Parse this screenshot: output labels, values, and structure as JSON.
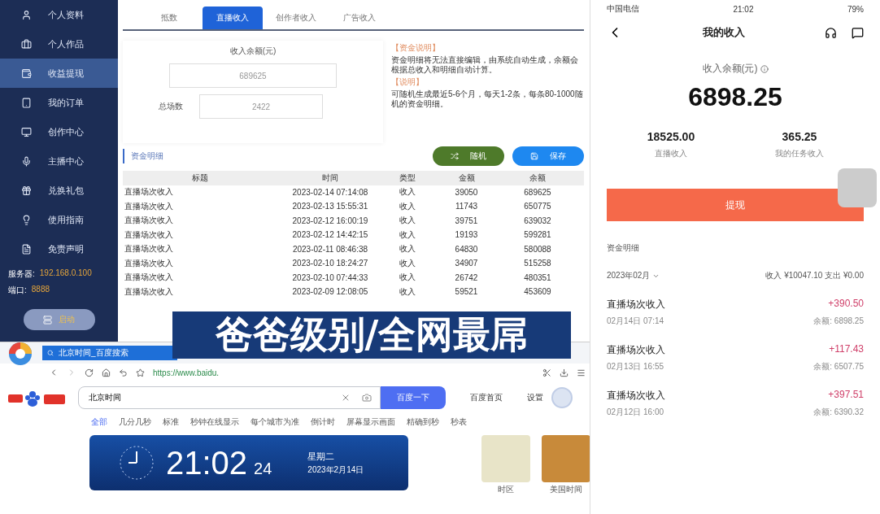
{
  "sidebar": {
    "items": [
      {
        "label": "个人资料",
        "selected": false
      },
      {
        "label": "个人作品",
        "selected": false
      },
      {
        "label": "收益提现",
        "selected": true
      },
      {
        "label": "我的订单",
        "selected": false
      },
      {
        "label": "创作中心",
        "selected": false
      },
      {
        "label": "主播中心",
        "selected": false
      },
      {
        "label": "兑换礼包",
        "selected": false
      },
      {
        "label": "使用指南",
        "selected": false
      },
      {
        "label": "免责声明",
        "selected": false
      }
    ],
    "server": {
      "label": "服务器:",
      "value": "192.168.0.100"
    },
    "port": {
      "label": "端口:",
      "value": "8888"
    },
    "start_button": "启动"
  },
  "tabs": [
    {
      "label": "抵数",
      "selected": false
    },
    {
      "label": "直播收入",
      "selected": true
    },
    {
      "label": "创作者收入",
      "selected": false
    },
    {
      "label": "广告收入",
      "selected": false
    }
  ],
  "form": {
    "balance_label": "收入余额(元)",
    "balance_value": "689625",
    "count_label": "总场数",
    "count_value": "2422"
  },
  "notes": [
    {
      "heading": "【资金说明】",
      "text": "资金明细将无法直接编辑，由系统自动生成，余额会根据总收入和明细自动计算。"
    },
    {
      "heading": "【说明】",
      "text": "可随机生成最近5-6个月，每天1-2条，每条80-1000随机的资金明细。"
    }
  ],
  "buttons": [
    {
      "kind": "random",
      "label": "随机"
    },
    {
      "kind": "save",
      "label": "保存"
    }
  ],
  "section_title": "资金明细",
  "table": {
    "columns": [
      "标题",
      "时间",
      "类型",
      "金额",
      "余额"
    ],
    "rows": [
      [
        "直播场次收入",
        "2023-02-14 07:14:08",
        "收入",
        "39050",
        "689625"
      ],
      [
        "直播场次收入",
        "2023-02-13 15:55:31",
        "收入",
        "11743",
        "650775"
      ],
      [
        "直播场次收入",
        "2023-02-12 16:00:19",
        "收入",
        "39751",
        "639032"
      ],
      [
        "直播场次收入",
        "2023-02-12 14:42:15",
        "收入",
        "19193",
        "599281"
      ],
      [
        "直播场次收入",
        "2023-02-11 08:46:38",
        "收入",
        "64830",
        "580088"
      ],
      [
        "直播场次收入",
        "2023-02-10 18:24:27",
        "收入",
        "34907",
        "515258"
      ],
      [
        "直播场次收入",
        "2023-02-10 07:44:33",
        "收入",
        "26742",
        "480351"
      ],
      [
        "直播场次收入",
        "2023-02-09 12:08:05",
        "收入",
        "59521",
        "453609"
      ]
    ]
  },
  "caption": "爸爸级别/全网最屌",
  "browser": {
    "tab_title": "北京时间_百度搜索",
    "url": "https://www.baidu.",
    "search_value": "北京时间",
    "search_button": "百度一下",
    "links": [
      "百度首页",
      "设置"
    ],
    "filters": [
      {
        "label": "全部",
        "selected": true
      },
      {
        "label": "几分几秒",
        "selected": false
      },
      {
        "label": "标准",
        "selected": false
      },
      {
        "label": "秒钟在线显示",
        "selected": false
      },
      {
        "label": "每个城市为准",
        "selected": false
      },
      {
        "label": "倒计时",
        "selected": false
      },
      {
        "label": "屏幕显示画面",
        "selected": false
      },
      {
        "label": "精确到秒",
        "selected": false
      },
      {
        "label": "秒表",
        "selected": false
      }
    ],
    "clock": {
      "time": "21:02",
      "seconds": "24",
      "weekday": "星期二",
      "date": "2023年2月14日"
    },
    "thumbnails": [
      "时区",
      "美国时间"
    ]
  },
  "phone": {
    "carrier": "中国电信",
    "time": "21:02",
    "battery": "79%",
    "title": "我的收入",
    "balance_label": "收入余额(元)",
    "balance": "6898.25",
    "stats": [
      {
        "value": "18525.00",
        "label": "直播收入"
      },
      {
        "value": "365.25",
        "label": "我的任务收入"
      }
    ],
    "withdraw": "提现",
    "details_title": "资金明细",
    "month": "2023年02月",
    "summary": "收入 ¥10047.10  支出 ¥0.00",
    "entries": [
      {
        "title": "直播场次收入",
        "date": "02月14日 07:14",
        "amount": "+390.50",
        "balance": "余额: 6898.25"
      },
      {
        "title": "直播场次收入",
        "date": "02月13日 16:55",
        "amount": "+117.43",
        "balance": "余额: 6507.75"
      },
      {
        "title": "直播场次收入",
        "date": "02月12日 16:00",
        "amount": "+397.51",
        "balance": "余额: 6390.32"
      }
    ]
  }
}
